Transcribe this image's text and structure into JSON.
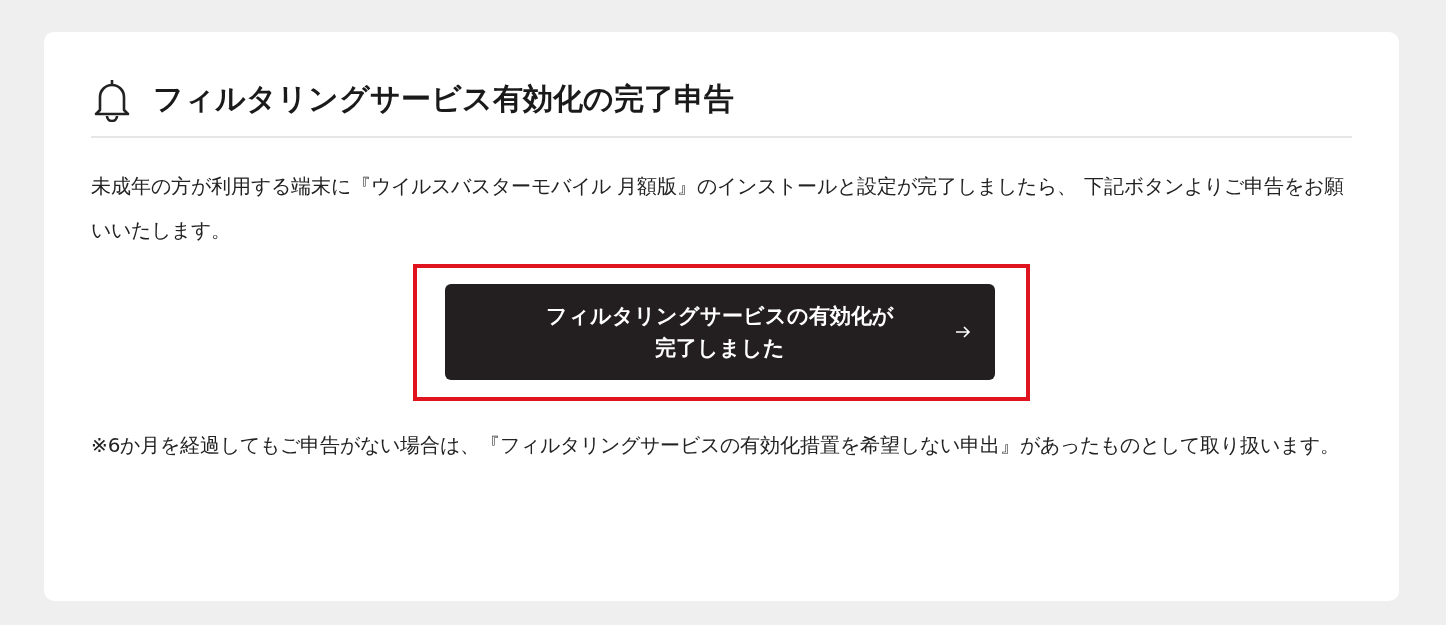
{
  "card": {
    "title": "フィルタリングサービス有効化の完了申告",
    "description": "未成年の方が利用する端末に『ウイルスバスターモバイル 月額版』のインストールと設定が完了しましたら、 下記ボタンよりご申告をお願いいたします。",
    "button": {
      "label_lines": [
        "フィルタリングサービスの有効化が",
        "完了しました"
      ],
      "highlighted": true
    },
    "note": "※6か月を経過してもご申告がない場合は、『フィルタリングサービスの有効化措置を希望しない申出』があったものとして取り扱います。"
  }
}
